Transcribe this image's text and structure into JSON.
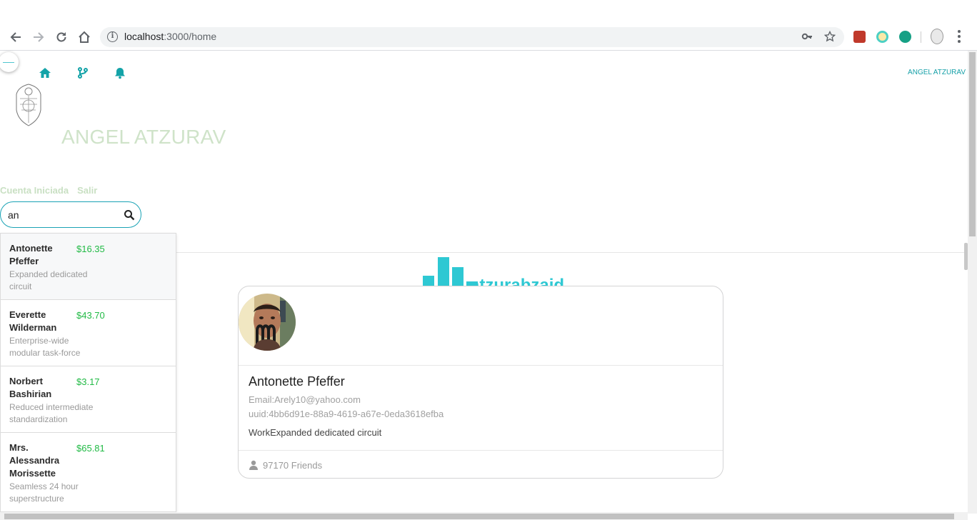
{
  "browser": {
    "url_host": "localhost",
    "url_path": ":3000/home"
  },
  "header": {
    "user_name_small": "ANGEL ATZURAV",
    "user_name_large": "ANGEL ATZURAV",
    "account_status": "Cuenta Iniciada",
    "logout": "Salir"
  },
  "search": {
    "value": "an"
  },
  "results": [
    {
      "name": "Antonette Pfeffer",
      "price": "$16.35",
      "description": "Expanded dedicated circuit"
    },
    {
      "name": "Everette Wilderman",
      "price": "$43.70",
      "description": "Enterprise-wide modular task-force"
    },
    {
      "name": "Norbert Bashirian",
      "price": "$3.17",
      "description": "Reduced intermediate standardization"
    },
    {
      "name": "Mrs. Alessandra Morissette",
      "price": "$65.81",
      "description": "Seamless 24 hour superstructure"
    }
  ],
  "brand": {
    "text": "atzurabzaid"
  },
  "profile": {
    "name": "Antonette Pfeffer",
    "email": "Email:Arely10@yahoo.com",
    "uuid": "uuid:4bb6d91e-88a9-4619-a67e-0eda3618efba",
    "work": "WorkExpanded dedicated circuit",
    "friends": "97170 Friends"
  },
  "colors": {
    "accent": "#14a3a8",
    "price_green": "#21ba45",
    "brand_cyan": "#2ec8d3"
  }
}
